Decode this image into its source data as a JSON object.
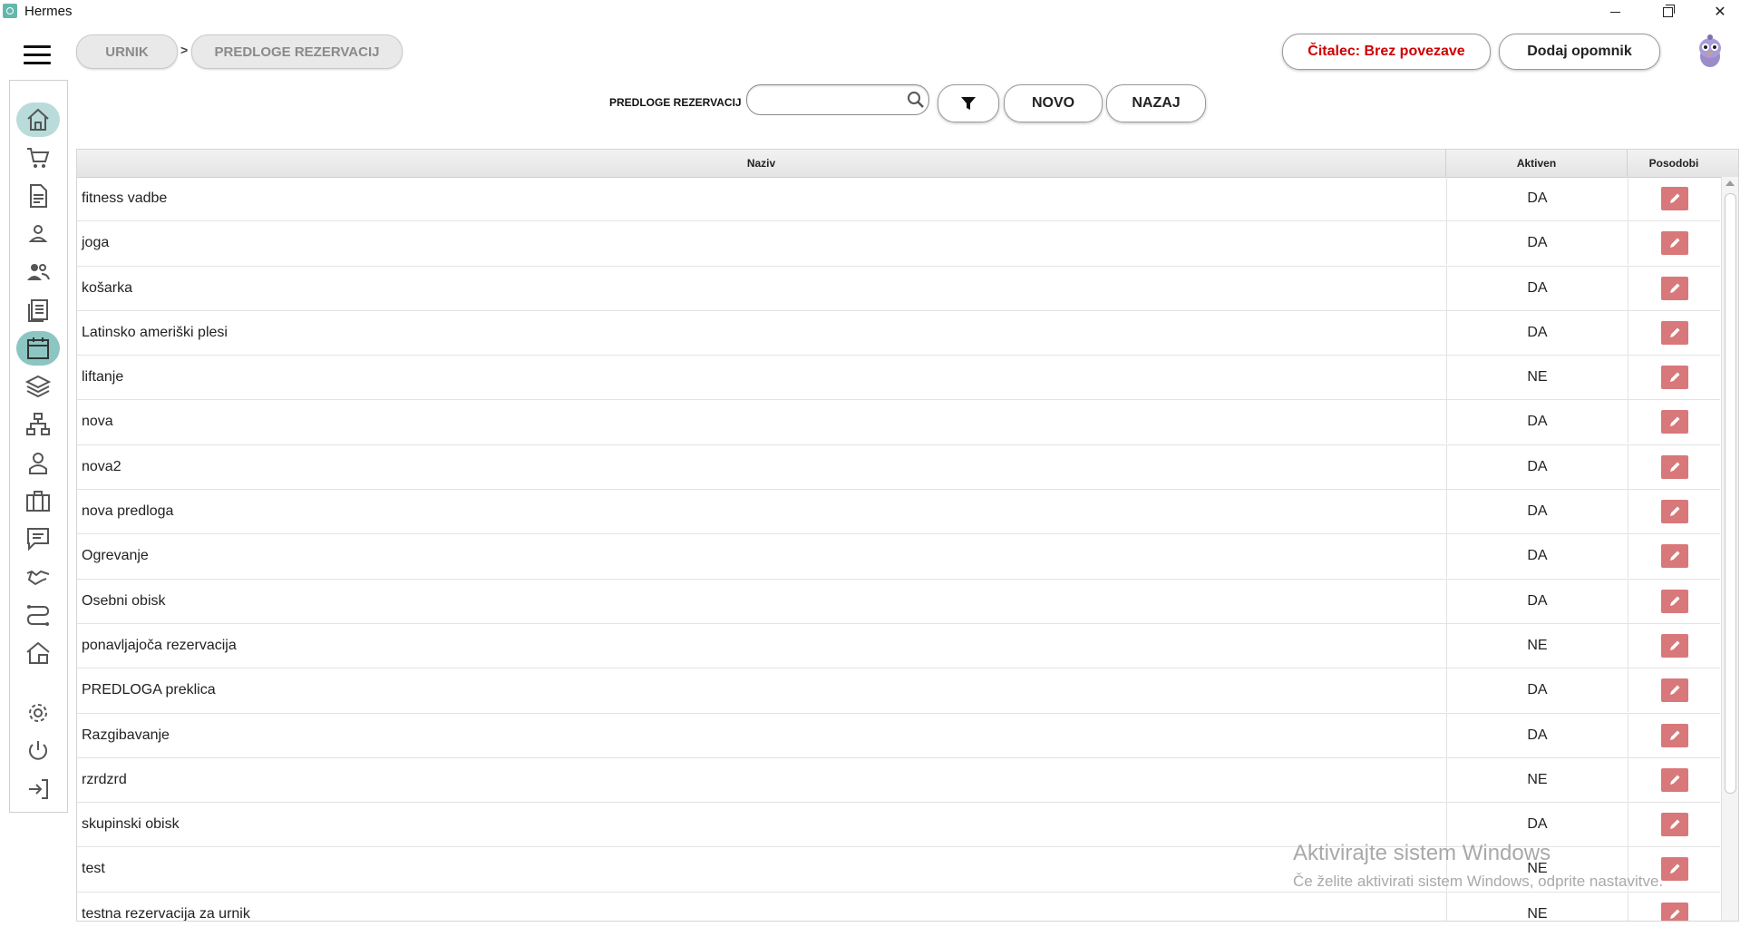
{
  "window": {
    "title": "Hermes",
    "controls": {
      "minimize": "minimize-icon",
      "maximize": "restore-icon",
      "close": "✕"
    }
  },
  "breadcrumb": {
    "items": [
      "URNIK",
      "PREDLOGE REZERVACIJ"
    ],
    "separator": ">"
  },
  "header": {
    "reader_status": "Čitalec: Brez povezave",
    "reader_status_color": "#d00000",
    "add_reminder": "Dodaj opomnik"
  },
  "search": {
    "label": "PREDLOGE REZERVACIJ",
    "value": "",
    "placeholder": ""
  },
  "actions": {
    "filter_icon": "filter-icon",
    "new": "NOVO",
    "back": "NAZAJ"
  },
  "sidebar": {
    "items": [
      {
        "icon": "home-icon",
        "state": "hover"
      },
      {
        "icon": "cart-icon"
      },
      {
        "icon": "document-icon"
      },
      {
        "icon": "user-icon"
      },
      {
        "icon": "users-icon"
      },
      {
        "icon": "list-document-icon"
      },
      {
        "icon": "calendar-icon",
        "state": "selected"
      },
      {
        "icon": "layers-icon"
      },
      {
        "icon": "hierarchy-icon"
      },
      {
        "icon": "staff-icon"
      },
      {
        "icon": "briefcase-icon"
      },
      {
        "icon": "chat-icon"
      },
      {
        "icon": "handshake-icon"
      },
      {
        "icon": "route-icon"
      },
      {
        "icon": "house-icon"
      },
      {
        "icon": "gear-icon"
      },
      {
        "icon": "power-icon"
      },
      {
        "icon": "logout-icon"
      }
    ]
  },
  "table": {
    "columns": [
      "Naziv",
      "Aktiven",
      "Posodobi"
    ],
    "edit_button_color": "#d8787a",
    "rows": [
      {
        "name": "fitness vadbe",
        "active": "DA"
      },
      {
        "name": "joga",
        "active": "DA"
      },
      {
        "name": "košarka",
        "active": "DA"
      },
      {
        "name": "Latinsko ameriški plesi",
        "active": "DA"
      },
      {
        "name": "liftanje",
        "active": "NE"
      },
      {
        "name": "nova",
        "active": "DA"
      },
      {
        "name": "nova2",
        "active": "DA"
      },
      {
        "name": "nova predloga",
        "active": "DA"
      },
      {
        "name": "Ogrevanje",
        "active": "DA"
      },
      {
        "name": "Osebni obisk",
        "active": "DA"
      },
      {
        "name": "ponavljajoča rezervacija",
        "active": "NE"
      },
      {
        "name": "PREDLOGA preklica",
        "active": "DA"
      },
      {
        "name": "Razgibavanje",
        "active": "DA"
      },
      {
        "name": "rzrdzrd",
        "active": "NE"
      },
      {
        "name": "skupinski obisk",
        "active": "DA"
      },
      {
        "name": "test",
        "active": "NE"
      },
      {
        "name": "testna rezervacija za urnik",
        "active": "NE"
      }
    ]
  },
  "watermark": {
    "line1": "Aktivirajte sistem Windows",
    "line2": "Če želite aktivirati sistem Windows, odprite nastavitve."
  }
}
